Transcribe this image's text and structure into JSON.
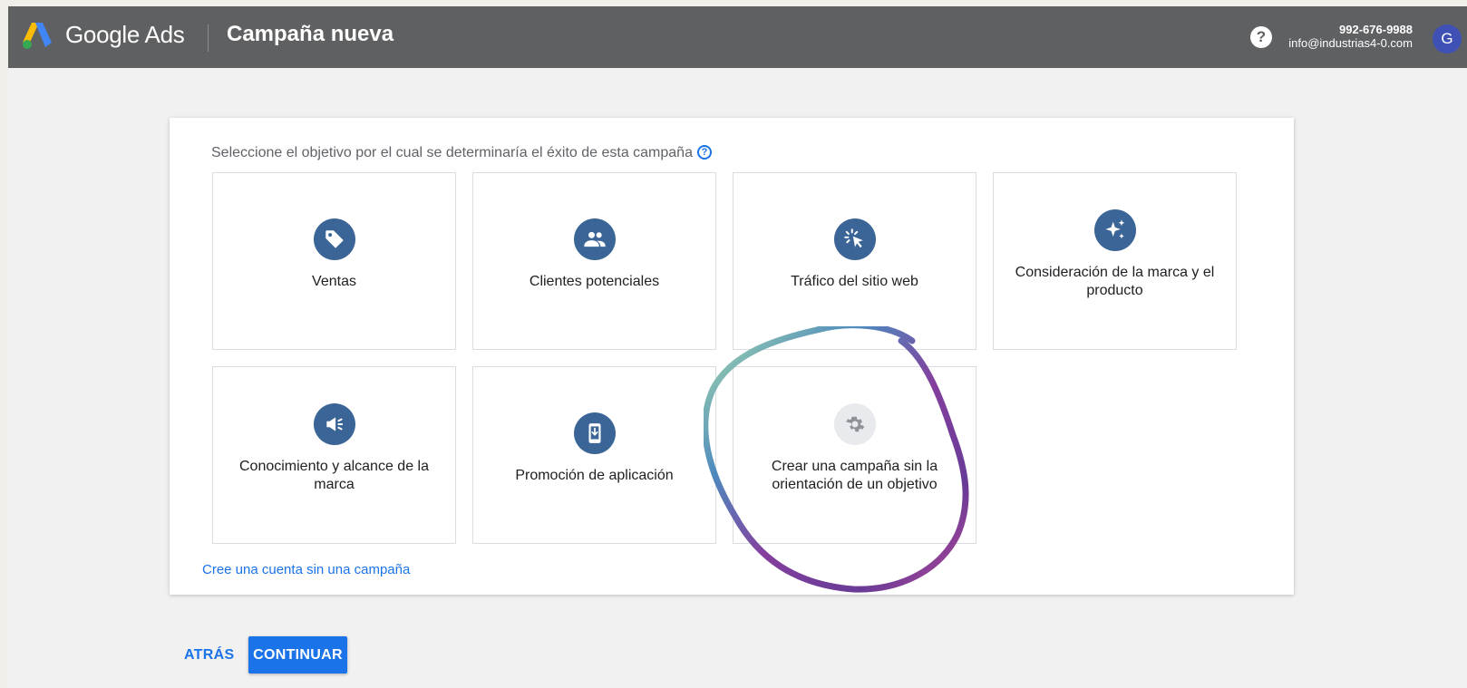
{
  "header": {
    "brand": "Google Ads",
    "title": "Campaña nueva",
    "help_symbol": "?",
    "account_phone": "992-676-9988",
    "account_email": "info@industrias4-0.com",
    "avatar_letter": "G",
    "background": "#5f6062"
  },
  "card": {
    "prompt": "Seleccione el objetivo por el cual se determinaría el éxito de esta campaña",
    "help_symbol": "?",
    "goals": [
      {
        "label": "Ventas",
        "icon": "sales-tag-icon"
      },
      {
        "label": "Clientes potenciales",
        "icon": "leads-people-icon"
      },
      {
        "label": "Tráfico del sitio web",
        "icon": "website-traffic-click-icon"
      },
      {
        "label": "Consideración de la marca y el producto",
        "icon": "sparkle-icon"
      },
      {
        "label": "Conocimiento y alcance de la marca",
        "icon": "megaphone-icon"
      },
      {
        "label": "Promoción de aplicación",
        "icon": "app-download-icon"
      },
      {
        "label": "Crear una campaña sin la orientación de un objetivo",
        "icon": "gear-icon"
      }
    ],
    "link": "Cree una cuenta sin una campaña"
  },
  "actions": {
    "back": "ATRÁS",
    "continue": "CONTINUAR"
  },
  "colors": {
    "accent": "#1a73e8",
    "icon_circle": "#3b6597",
    "icon_circle_disabled": "#e8eaed"
  }
}
